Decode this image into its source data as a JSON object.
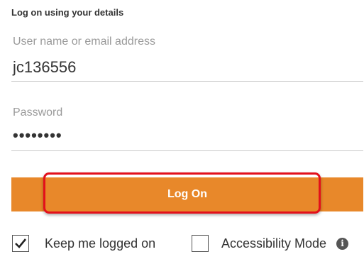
{
  "form": {
    "heading": "Log on using your details",
    "username": {
      "label": "User name or email address",
      "value": "jc136556"
    },
    "password": {
      "label": "Password",
      "masked_value": "••••••••"
    },
    "login_button": "Log On",
    "keep_logged_on": {
      "label": "Keep me logged on",
      "checked": true
    },
    "accessibility_mode": {
      "label": "Accessibility Mode",
      "checked": false,
      "info_icon": "info-icon",
      "info_glyph": "i"
    }
  },
  "colors": {
    "button": "#e8882a",
    "highlight": "#e3101b",
    "underline": "#c8c8c8"
  }
}
